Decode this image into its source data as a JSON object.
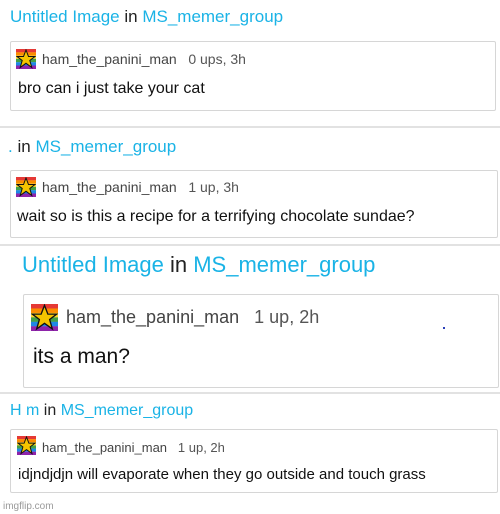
{
  "threads": [
    {
      "title": "Untitled Image",
      "joiner": "in",
      "group": "MS_memer_group",
      "comment": {
        "username": "ham_the_panini_man",
        "info": "0 ups, 3h",
        "text": "bro can i just take your cat"
      }
    },
    {
      "title": ".",
      "joiner": "in",
      "group": "MS_memer_group",
      "comment": {
        "username": "ham_the_panini_man",
        "info": "1 up, 3h",
        "text": "wait so is this a recipe for a terrifying chocolate sundae?"
      }
    },
    {
      "title": "Untitled Image",
      "joiner": "in",
      "group": "MS_memer_group",
      "comment": {
        "username": "ham_the_panini_man",
        "info": "1 up, 2h",
        "text": "its a man?"
      }
    },
    {
      "title": "H m",
      "joiner": "in",
      "group": "MS_memer_group",
      "comment": {
        "username": "ham_the_panini_man",
        "info": "1 up, 2h",
        "text": "idjndjdjn will evaporate when they go outside and touch grass"
      }
    }
  ],
  "watermark": "imgflip.com",
  "colors": {
    "link": "#1ab3e6",
    "border": "#d6d6d6",
    "separator": "#e2e2e2"
  },
  "icons": {
    "avatar": "rainbow-star-icon"
  }
}
